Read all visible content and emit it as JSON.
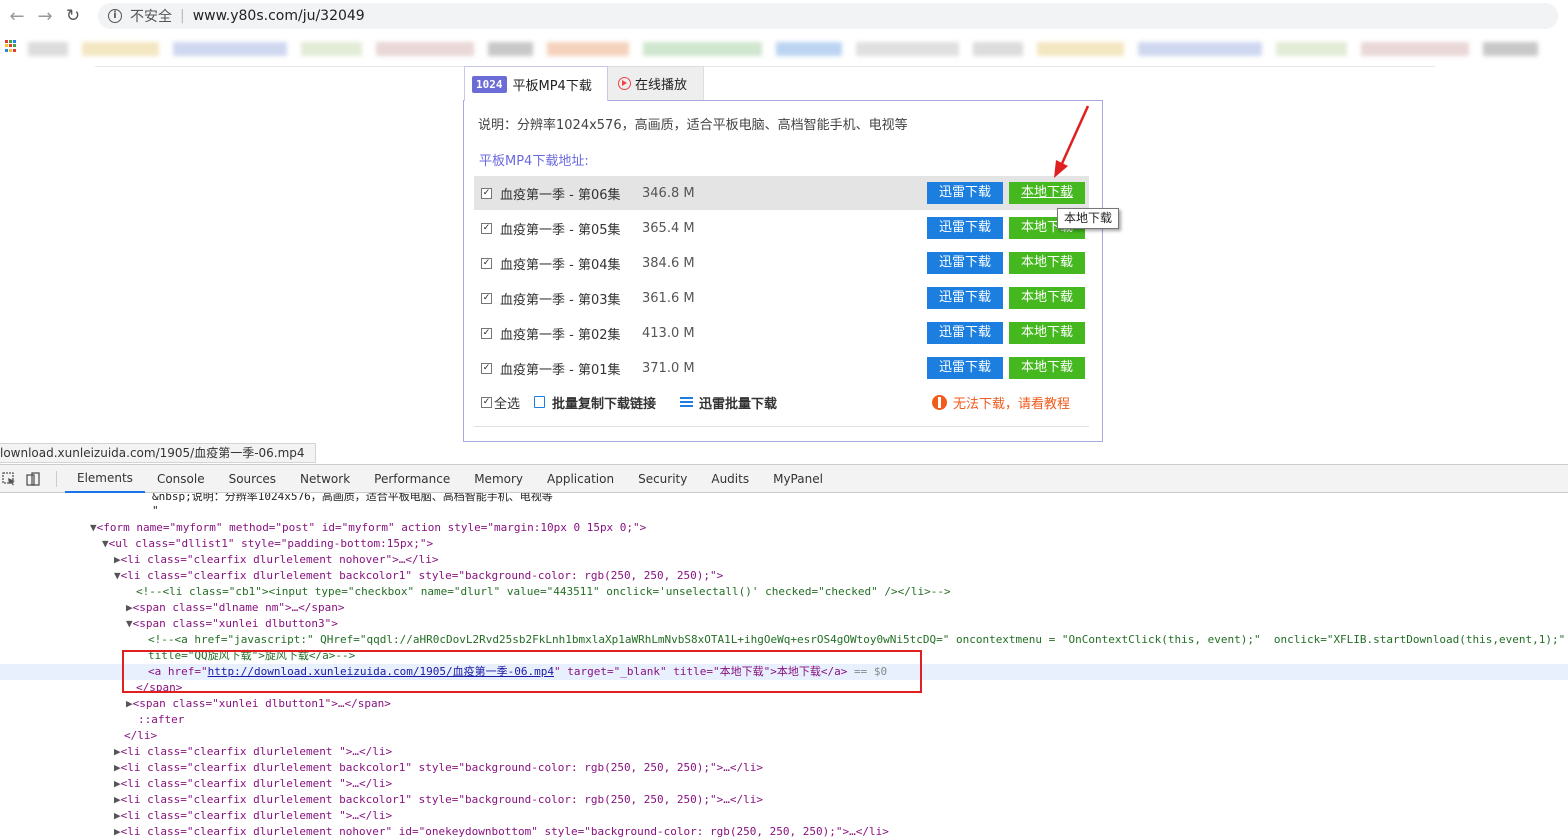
{
  "browser": {
    "security_label": "不安全",
    "url": "www.y80s.com/ju/32049",
    "bookmark_colors": [
      "#dcdcdc",
      "#f3e7c2",
      "#cfd8f0",
      "#e3ecd6",
      "#ead7d7",
      "#c8c8c8",
      "#f5d2bd",
      "#cfe6cf",
      "#bcd4f2",
      "#e0e0e0"
    ]
  },
  "tabs": {
    "mp4": {
      "badge": "1024",
      "label": "平板MP4下载"
    },
    "online": {
      "label": "在线播放"
    }
  },
  "panel": {
    "description": "说明：分辨率1024x576，高画质，适合平板电脑、高档智能手机、电视等",
    "list_title": "平板MP4下载地址:",
    "xunlei_label": "迅雷下载",
    "local_label": "本地下载",
    "episodes": [
      {
        "name": "血疫第一季 - 第06集",
        "size": "346.8 M"
      },
      {
        "name": "血疫第一季 - 第05集",
        "size": "365.4 M"
      },
      {
        "name": "血疫第一季 - 第04集",
        "size": "384.6 M"
      },
      {
        "name": "血疫第一季 - 第03集",
        "size": "361.6 M"
      },
      {
        "name": "血疫第一季 - 第02集",
        "size": "413.0 M"
      },
      {
        "name": "血疫第一季 - 第01集",
        "size": "371.0 M"
      }
    ],
    "select_all": "全选",
    "copy_links": "批量复制下载链接",
    "batch_xunlei": "迅雷批量下载",
    "help": "无法下载，请看教程",
    "tooltip": "本地下载"
  },
  "status_url": "lownload.xunleizuida.com/1905/血疫第一季-06.mp4",
  "devtools": {
    "tabs": [
      "Elements",
      "Console",
      "Sources",
      "Network",
      "Performance",
      "Memory",
      "Application",
      "Security",
      "Audits",
      "MyPanel"
    ],
    "lines": {
      "l0": "&nbsp;说明：分辨率1024x576，高画质，适合平板电脑、高档智能手机、电视等",
      "l1": "\"",
      "form_open": "<form name=\"myform\" method=\"post\" id=\"myform\" action style=\"margin:10px 0 15px 0;\">",
      "ul_open": "<ul class=\"dllist1\" style=\"padding-bottom:15px;\">",
      "li_nohover": "<li class=\"clearfix dlurlelement nohover\">…</li>",
      "li_back_open": "<li class=\"clearfix dlurlelement backcolor1\" style=\"background-color: rgb(250, 250, 250);\">",
      "comment_cb": "<!--<li class=\"cb1\"><input type=\"checkbox\" name=\"dlurl\" value=\"443511\" onclick='unselectall()' checked=\"checked\" /></li>-->",
      "span_dlname": "<span class=\"dlname nm\">…</span>",
      "span_xunlei3": "<span class=\"xunlei dlbutton3\">",
      "comment_qqdl": "<!--<a href=\"javascript:\" QHref=\"qqdl://aHR0cDovL2Rvd25sb2FkLnh1bmxlaXp1aWRhLmNvbS8xOTA1L+ihgOeWq+esrOS4gOWtoy0wNi5tcDQ=\" oncontextmenu = \"OnContextClick(this, event);\"  onclick=\"XFLIB.startDownload(this,event,1);\"",
      "comment_title": "title=\"QQ旋风下载\">旋风下载</a>-->",
      "a_href_prefix": "<a href=\"",
      "a_href": "http://download.xunleizuida.com/1905/血疫第一季-06.mp4",
      "a_rest": "\" target=\"_blank\" title=\"本地下载\">本地下载</a>",
      "a_eq": " == $0",
      "span_close": "</span>",
      "span_xunlei1": "<span class=\"xunlei dlbutton1\">…</span>",
      "after": "::after",
      "li_close": "</li>",
      "li_plain": "<li class=\"clearfix dlurlelement \">…</li>",
      "li_back": "<li class=\"clearfix dlurlelement backcolor1\" style=\"background-color: rgb(250, 250, 250);\">…</li>",
      "li_onekey": "<li class=\"clearfix dlurlelement nohover\" id=\"onekeydownbottom\" style=\"background-color: rgb(250, 250, 250);\">…</li>"
    }
  },
  "colors": {
    "xunlei_blue": "#1c7fe0",
    "local_green": "#45b81f",
    "accent_purple": "#6a6ae0",
    "warn_orange": "#f05a1a",
    "annotation_red": "#e02020"
  }
}
